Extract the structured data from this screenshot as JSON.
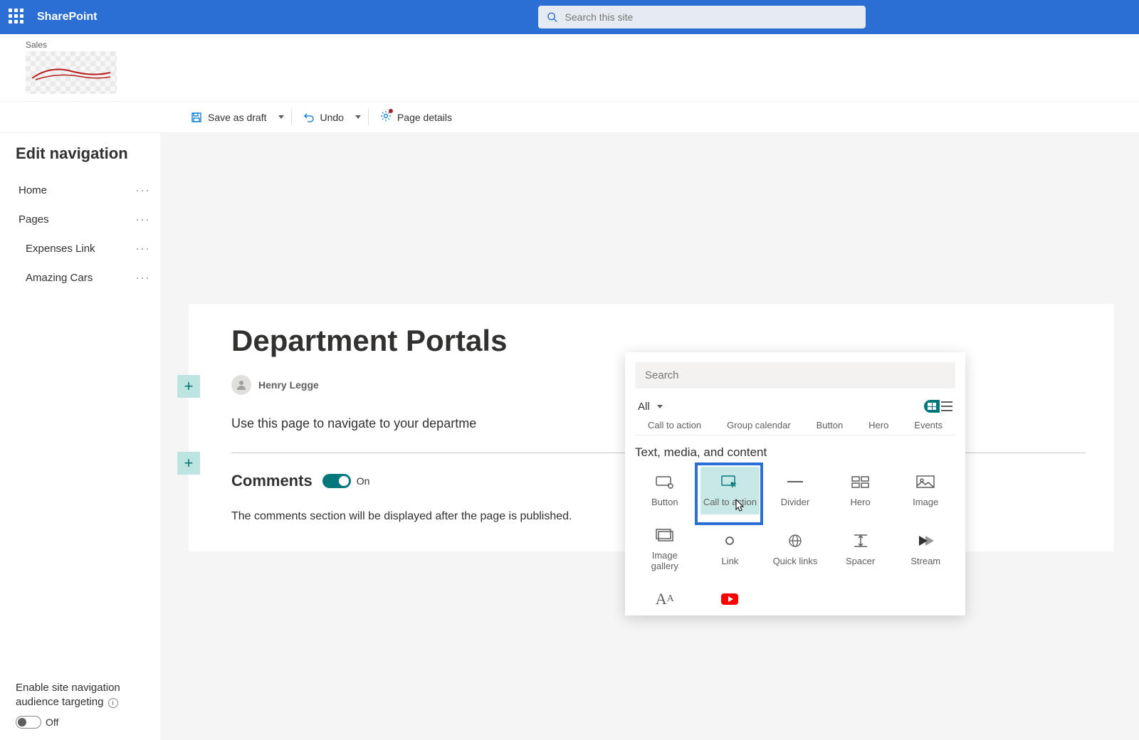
{
  "app": {
    "name": "SharePoint"
  },
  "search": {
    "placeholder": "Search this site"
  },
  "site": {
    "label": "Sales"
  },
  "commands": {
    "save_draft": "Save as draft",
    "undo": "Undo",
    "page_details": "Page details"
  },
  "sidebar": {
    "title": "Edit navigation",
    "items": [
      {
        "label": "Home"
      },
      {
        "label": "Pages"
      },
      {
        "label": "Expenses Link"
      },
      {
        "label": "Amazing Cars"
      }
    ],
    "audience_targeting_label": "Enable site navigation audience targeting",
    "toggle_off_label": "Off"
  },
  "page": {
    "title": "Department Portals",
    "author": "Henry Legge",
    "body_text": "Use this page to navigate to your departme",
    "comments_header": "Comments",
    "comments_toggle_label": "On",
    "comments_note": "The comments section will be displayed after the page is published."
  },
  "picker": {
    "search_placeholder": "Search",
    "filter_label": "All",
    "peek_row": [
      "Call to action",
      "Group calendar",
      "Button",
      "Hero",
      "Events"
    ],
    "category": "Text, media, and content",
    "webparts_row1": [
      {
        "name": "Button",
        "icon": "button"
      },
      {
        "name": "Call to action",
        "icon": "cta",
        "selected": true
      },
      {
        "name": "Divider",
        "icon": "divider"
      },
      {
        "name": "Hero",
        "icon": "hero"
      },
      {
        "name": "Image",
        "icon": "image"
      }
    ],
    "webparts_row2": [
      {
        "name": "Image gallery",
        "icon": "gallery"
      },
      {
        "name": "Link",
        "icon": "link"
      },
      {
        "name": "Quick links",
        "icon": "quicklinks"
      },
      {
        "name": "Spacer",
        "icon": "spacer"
      },
      {
        "name": "Stream",
        "icon": "stream"
      }
    ],
    "webparts_row3": [
      {
        "name": "",
        "icon": "text"
      },
      {
        "name": "",
        "icon": "youtube"
      }
    ]
  }
}
